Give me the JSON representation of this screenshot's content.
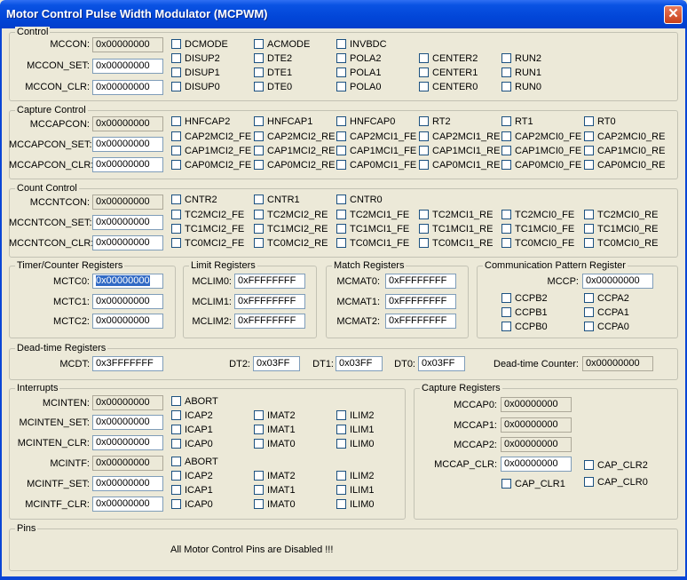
{
  "window": {
    "title": "Motor Control Pulse Width Modulator (MCPWM)",
    "close_glyph": "✕"
  },
  "control": {
    "title": "Control",
    "MCCON": {
      "label": "MCCON:",
      "value": "0x00000000"
    },
    "MCCON_SET": {
      "label": "MCCON_SET:",
      "value": "0x00000000"
    },
    "MCCON_CLR": {
      "label": "MCCON_CLR:",
      "value": "0x00000000"
    },
    "cb": {
      "DCMODE": "DCMODE",
      "ACMODE": "ACMODE",
      "INVBDC": "INVBDC",
      "DISUP2": "DISUP2",
      "DTE2": "DTE2",
      "POLA2": "POLA2",
      "CENTER2": "CENTER2",
      "RUN2": "RUN2",
      "DISUP1": "DISUP1",
      "DTE1": "DTE1",
      "POLA1": "POLA1",
      "CENTER1": "CENTER1",
      "RUN1": "RUN1",
      "DISUP0": "DISUP0",
      "DTE0": "DTE0",
      "POLA0": "POLA0",
      "CENTER0": "CENTER0",
      "RUN0": "RUN0"
    }
  },
  "capture_control": {
    "title": "Capture Control",
    "MCCAPCON": {
      "label": "MCCAPCON:",
      "value": "0x00000000"
    },
    "MCCAPCON_SET": {
      "label": "MCCAPCON_SET:",
      "value": "0x00000000"
    },
    "MCCAPCON_CLR": {
      "label": "MCCAPCON_CLR:",
      "value": "0x00000000"
    },
    "cb": {
      "HNFCAP2": "HNFCAP2",
      "HNFCAP1": "HNFCAP1",
      "HNFCAP0": "HNFCAP0",
      "RT2": "RT2",
      "RT1": "RT1",
      "RT0": "RT0",
      "CAP2MCI2_FE": "CAP2MCI2_FE",
      "CAP2MCI2_RE": "CAP2MCI2_RE",
      "CAP2MCI1_FE": "CAP2MCI1_FE",
      "CAP2MCI1_RE": "CAP2MCI1_RE",
      "CAP2MCI0_FE": "CAP2MCI0_FE",
      "CAP2MCI0_RE": "CAP2MCI0_RE",
      "CAP1MCI2_FE": "CAP1MCI2_FE",
      "CAP1MCI2_RE": "CAP1MCI2_RE",
      "CAP1MCI1_FE": "CAP1MCI1_FE",
      "CAP1MCI1_RE": "CAP1MCI1_RE",
      "CAP1MCI0_FE": "CAP1MCI0_FE",
      "CAP1MCI0_RE": "CAP1MCI0_RE",
      "CAP0MCI2_FE": "CAP0MCI2_FE",
      "CAP0MCI2_RE": "CAP0MCI2_RE",
      "CAP0MCI1_FE": "CAP0MCI1_FE",
      "CAP0MCI1_RE": "CAP0MCI1_RE",
      "CAP0MCI0_FE": "CAP0MCI0_FE",
      "CAP0MCI0_RE": "CAP0MCI0_RE"
    }
  },
  "count_control": {
    "title": "Count Control",
    "MCCNTCON": {
      "label": "MCCNTCON:",
      "value": "0x00000000"
    },
    "MCCNTCON_SET": {
      "label": "MCCNTCON_SET:",
      "value": "0x00000000"
    },
    "MCCNTCON_CLR": {
      "label": "MCCNTCON_CLR:",
      "value": "0x00000000"
    },
    "cb": {
      "CNTR2": "CNTR2",
      "CNTR1": "CNTR1",
      "CNTR0": "CNTR0",
      "TC2MCI2_FE": "TC2MCI2_FE",
      "TC2MCI2_RE": "TC2MCI2_RE",
      "TC2MCI1_FE": "TC2MCI1_FE",
      "TC2MCI1_RE": "TC2MCI1_RE",
      "TC2MCI0_FE": "TC2MCI0_FE",
      "TC2MCI0_RE": "TC2MCI0_RE",
      "TC1MCI2_FE": "TC1MCI2_FE",
      "TC1MCI2_RE": "TC1MCI2_RE",
      "TC1MCI1_FE": "TC1MCI1_FE",
      "TC1MCI1_RE": "TC1MCI1_RE",
      "TC1MCI0_FE": "TC1MCI0_FE",
      "TC1MCI0_RE": "TC1MCI0_RE",
      "TC0MCI2_FE": "TC0MCI2_FE",
      "TC0MCI2_RE": "TC0MCI2_RE",
      "TC0MCI1_FE": "TC0MCI1_FE",
      "TC0MCI1_RE": "TC0MCI1_RE",
      "TC0MCI0_FE": "TC0MCI0_FE",
      "TC0MCI0_RE": "TC0MCI0_RE"
    }
  },
  "timer": {
    "title": "Timer/Counter Registers",
    "MCTC0": {
      "label": "MCTC0:",
      "value": "0x00000000"
    },
    "MCTC1": {
      "label": "MCTC1:",
      "value": "0x00000000"
    },
    "MCTC2": {
      "label": "MCTC2:",
      "value": "0x00000000"
    }
  },
  "limit": {
    "title": "Limit Registers",
    "MCLIM0": {
      "label": "MCLIM0:",
      "value": "0xFFFFFFFF"
    },
    "MCLIM1": {
      "label": "MCLIM1:",
      "value": "0xFFFFFFFF"
    },
    "MCLIM2": {
      "label": "MCLIM2:",
      "value": "0xFFFFFFFF"
    }
  },
  "match": {
    "title": "Match Registers",
    "MCMAT0": {
      "label": "MCMAT0:",
      "value": "0xFFFFFFFF"
    },
    "MCMAT1": {
      "label": "MCMAT1:",
      "value": "0xFFFFFFFF"
    },
    "MCMAT2": {
      "label": "MCMAT2:",
      "value": "0xFFFFFFFF"
    }
  },
  "comm": {
    "title": "Communication Pattern Register",
    "MCCP": {
      "label": "MCCP:",
      "value": "0x00000000"
    },
    "cb": {
      "CCPB2": "CCPB2",
      "CCPA2": "CCPA2",
      "CCPB1": "CCPB1",
      "CCPA1": "CCPA1",
      "CCPB0": "CCPB0",
      "CCPA0": "CCPA0"
    }
  },
  "deadtime": {
    "title": "Dead-time Registers",
    "MCDT": {
      "label": "MCDT:",
      "value": "0x3FFFFFFF"
    },
    "DT2": {
      "label": "DT2:",
      "value": "0x03FF"
    },
    "DT1": {
      "label": "DT1:",
      "value": "0x03FF"
    },
    "DT0": {
      "label": "DT0:",
      "value": "0x03FF"
    },
    "counter": {
      "label": "Dead-time Counter:",
      "value": "0x00000000"
    }
  },
  "interrupts": {
    "title": "Interrupts",
    "MCINTEN": {
      "label": "MCINTEN:",
      "value": "0x00000000"
    },
    "MCINTEN_SET": {
      "label": "MCINTEN_SET:",
      "value": "0x00000000"
    },
    "MCINTEN_CLR": {
      "label": "MCINTEN_CLR:",
      "value": "0x00000000"
    },
    "MCINTF": {
      "label": "MCINTF:",
      "value": "0x00000000"
    },
    "MCINTF_SET": {
      "label": "MCINTF_SET:",
      "value": "0x00000000"
    },
    "MCINTF_CLR": {
      "label": "MCINTF_CLR:",
      "value": "0x00000000"
    },
    "cb": {
      "ABORT": "ABORT",
      "ICAP2": "ICAP2",
      "IMAT2": "IMAT2",
      "ILIM2": "ILIM2",
      "ICAP1": "ICAP1",
      "IMAT1": "IMAT1",
      "ILIM1": "ILIM1",
      "ICAP0": "ICAP0",
      "IMAT0": "IMAT0",
      "ILIM0": "ILIM0"
    }
  },
  "capregs": {
    "title": "Capture Registers",
    "MCCAP0": {
      "label": "MCCAP0:",
      "value": "0x00000000"
    },
    "MCCAP1": {
      "label": "MCCAP1:",
      "value": "0x00000000"
    },
    "MCCAP2": {
      "label": "MCCAP2:",
      "value": "0x00000000"
    },
    "MCCAP_CLR": {
      "label": "MCCAP_CLR:",
      "value": "0x00000000"
    },
    "cb": {
      "CAP_CLR2": "CAP_CLR2",
      "CAP_CLR1": "CAP_CLR1",
      "CAP_CLR0": "CAP_CLR0"
    }
  },
  "pins": {
    "title": "Pins",
    "message": "All Motor Control Pins are Disabled !!!"
  }
}
